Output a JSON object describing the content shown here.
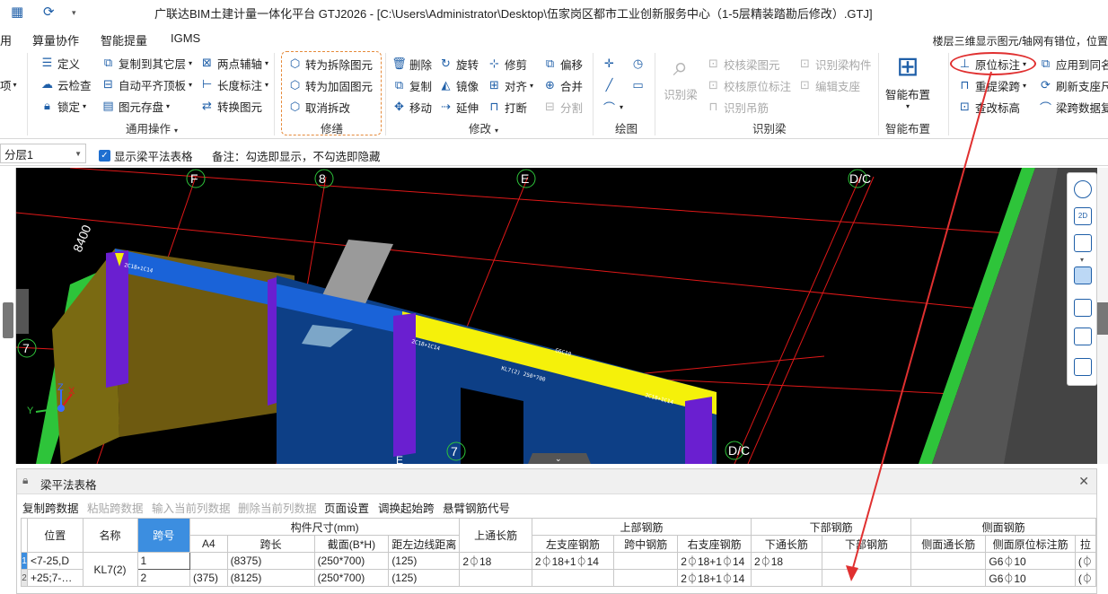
{
  "window": {
    "title": "广联达BIM土建计量一体化平台 GTJ2026 - [C:\\Users\\Administrator\\Desktop\\伍家岗区都市工业创新服务中心（1-5层精装踏勘后修改）.GTJ]"
  },
  "menu": {
    "items": [
      "用",
      "算量协作",
      "智能提量",
      "IGMS"
    ],
    "notice": "楼层三维显示图元/轴网有错位，位置"
  },
  "ribbon": {
    "col0": {
      "item": "项"
    },
    "general": {
      "items": [
        "定义",
        "云检查",
        "锁定",
        "复制到其它层",
        "自动平齐顶板",
        "图元存盘",
        "两点辅轴",
        "长度标注",
        "转换图元"
      ],
      "label": "通用操作"
    },
    "repair": {
      "items": [
        "转为拆除图元",
        "转为加固图元",
        "取消拆改"
      ],
      "label": "修缮"
    },
    "modify": {
      "items": [
        "删除",
        "旋转",
        "修剪",
        "偏移",
        "复制",
        "镜像",
        "对齐",
        "合并",
        "移动",
        "延伸",
        "打断",
        "分割"
      ],
      "label": "修改"
    },
    "draw": {
      "label": "绘图"
    },
    "identify": {
      "big": "识别梁",
      "items": [
        "校核梁图元",
        "识别梁构件",
        "校核原位标注",
        "编辑支座",
        "识别吊筋"
      ],
      "label": "识别梁"
    },
    "smart": {
      "big": "智能布置",
      "label": "智能布置"
    },
    "annotate": {
      "items": [
        "原位标注",
        "应用到同名",
        "重提梁跨",
        "刷新支座尺",
        "查改标高",
        "梁跨数据复"
      ]
    }
  },
  "optionbar": {
    "floor": "分层1",
    "show_table": "显示梁平法表格",
    "remark": "备注：勾选即显示，不勾选即隐藏"
  },
  "viewport": {
    "axis_labels": [
      "F",
      "8",
      "E",
      "D/C",
      "7",
      "7",
      "D/C",
      "E"
    ],
    "dimension": "8400",
    "axes": [
      "X",
      "Y",
      "Z"
    ]
  },
  "panel": {
    "title": "梁平法表格",
    "toolbar": [
      "复制跨数据",
      "粘贴跨数据",
      "输入当前列数据",
      "删除当前列数据",
      "页面设置",
      "调换起始跨",
      "悬臂钢筋代号"
    ],
    "table": {
      "headers": {
        "position": "位置",
        "name": "名称",
        "span": "跨号",
        "section_group": "构件尺寸(mm)",
        "a4": "A4",
        "span_len": "跨长",
        "section": "截面(B*H)",
        "edge": "距左边线距离",
        "top_cont": "上通长筋",
        "top_group": "上部钢筋",
        "left_seat": "左支座钢筋",
        "mid": "跨中钢筋",
        "right_seat": "右支座钢筋",
        "bottom_group": "下部钢筋",
        "bottom_cont": "下通长筋",
        "bottom": "下部钢筋",
        "side_group": "侧面钢筋",
        "side_cont": "侧面通长筋",
        "side_orig": "侧面原位标注筋",
        "extra": "拉"
      },
      "rows": [
        {
          "num": "1",
          "position": "<7-25,D",
          "name": "KL7(2)",
          "span": "1",
          "a4": "",
          "span_len": "(8375)",
          "section": "(250*700)",
          "edge": "(125)",
          "top_cont": "2⏀18",
          "left_seat": "2⏀18+1⏀14",
          "mid": "",
          "right_seat": "2⏀18+1⏀14",
          "bottom_cont": "2⏀18",
          "bottom": "",
          "side_cont": "",
          "side_orig": "G6⏀10",
          "extra": "(⏀"
        },
        {
          "num": "2",
          "position": "+25;7-…",
          "name": "",
          "span": "2",
          "a4": "(375)",
          "span_len": "(8125)",
          "section": "(250*700)",
          "edge": "(125)",
          "top_cont": "",
          "left_seat": "",
          "mid": "",
          "right_seat": "2⏀18+1⏀14",
          "bottom_cont": "",
          "bottom": "",
          "side_cont": "",
          "side_orig": "G6⏀10",
          "extra": "(⏀"
        }
      ]
    }
  },
  "colors": {
    "accent": "#1f5fa8",
    "highlight": "#e03030",
    "repair_box": "#e58a3a",
    "beam_blue": "#1a63d8",
    "beam_yellow": "#f5f10a",
    "column_purple": "#6a1fd0",
    "grid_red": "#e01818",
    "slab_green": "#2ec43a"
  }
}
